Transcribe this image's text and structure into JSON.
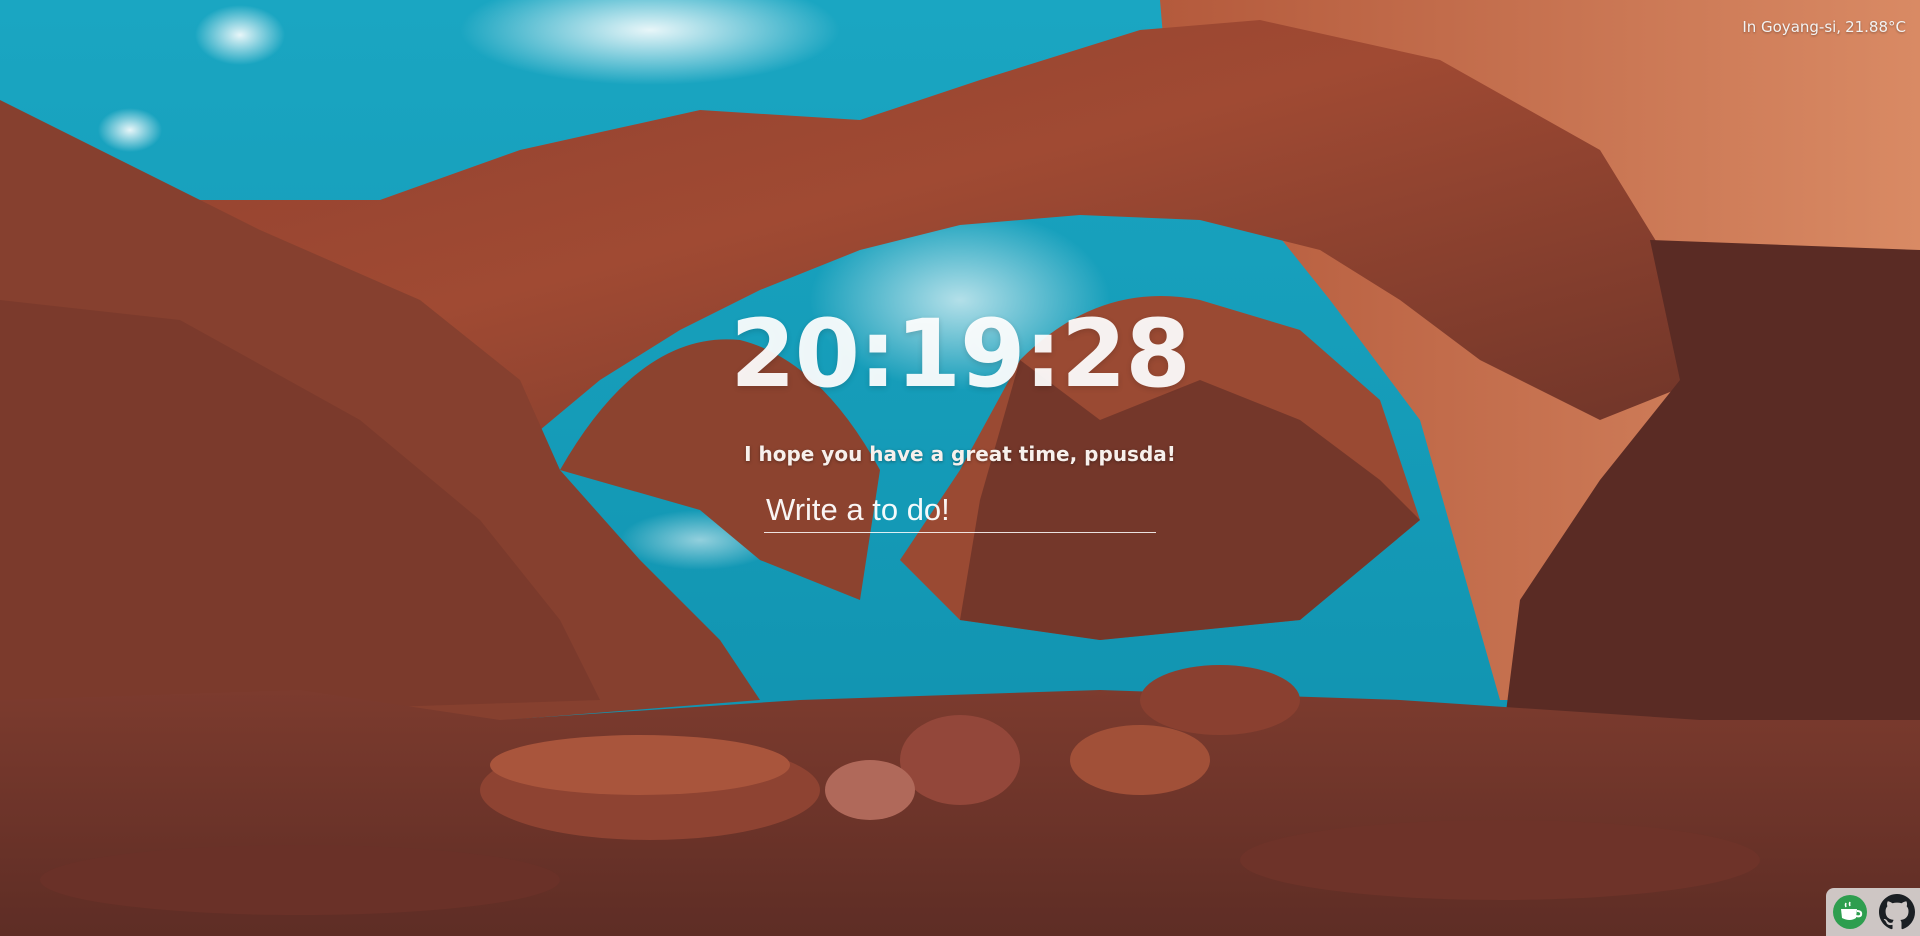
{
  "weather": {
    "location_text": "In Goyang-si,",
    "temperature": "21.88°C"
  },
  "clock": {
    "time": "20:19:28"
  },
  "greeting": {
    "text": "I hope you have a great time, ppusda!"
  },
  "todo": {
    "placeholder": "Write a to do!",
    "items": []
  },
  "dock": {
    "icons": [
      "coffee-icon",
      "github-icon"
    ]
  },
  "background": {
    "subject": "red sandstone double arch under blue sky",
    "colors": {
      "sky": "#16a3bf",
      "rock_light": "#c66a48",
      "rock_dark": "#5a2a22"
    }
  }
}
